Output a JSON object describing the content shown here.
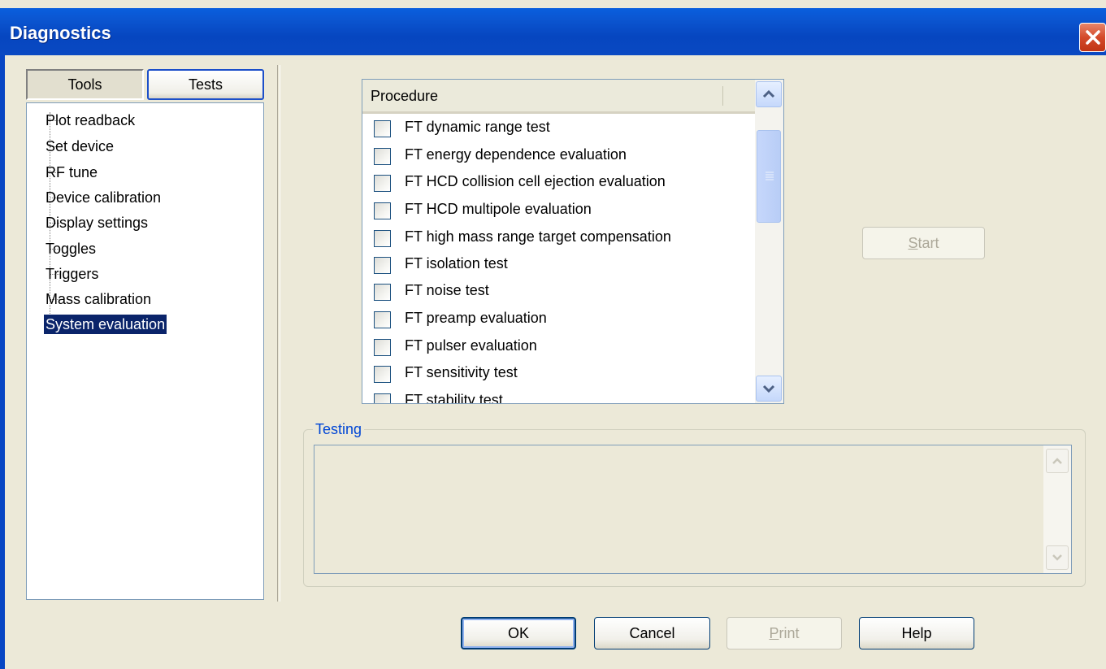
{
  "window": {
    "title": "Diagnostics"
  },
  "icons": {
    "close": "close-icon",
    "scroll_up": "chevron-up-icon",
    "scroll_down": "chevron-down-icon"
  },
  "colors": {
    "titlebar": "#0a5fde",
    "selection": "#0a246a",
    "group_label": "#0046d5"
  },
  "mode_buttons": {
    "tools": "Tools",
    "tests": "Tests"
  },
  "tree": {
    "items": [
      "Plot readback",
      "Set device",
      "RF tune",
      "Device calibration",
      "Display settings",
      "Toggles",
      "Triggers",
      "Mass calibration",
      "System evaluation"
    ],
    "selected": "System evaluation"
  },
  "procedure": {
    "header": "Procedure",
    "items": [
      "FT dynamic range test",
      "FT energy dependence evaluation",
      "FT HCD collision cell ejection evaluation",
      "FT HCD multipole evaluation",
      "FT high mass range target compensation",
      "FT isolation test",
      "FT noise test",
      "FT preamp evaluation",
      "FT pulser evaluation",
      "FT sensitivity test",
      "FT stability test"
    ]
  },
  "start_button": {
    "label_prefix": "",
    "label_mnemonic": "S",
    "label_rest": "tart"
  },
  "testing": {
    "label": "Testing",
    "text": ""
  },
  "footer": {
    "ok": "OK",
    "cancel": "Cancel",
    "print_mnemonic": "P",
    "print_rest": "rint",
    "help": "Help"
  }
}
